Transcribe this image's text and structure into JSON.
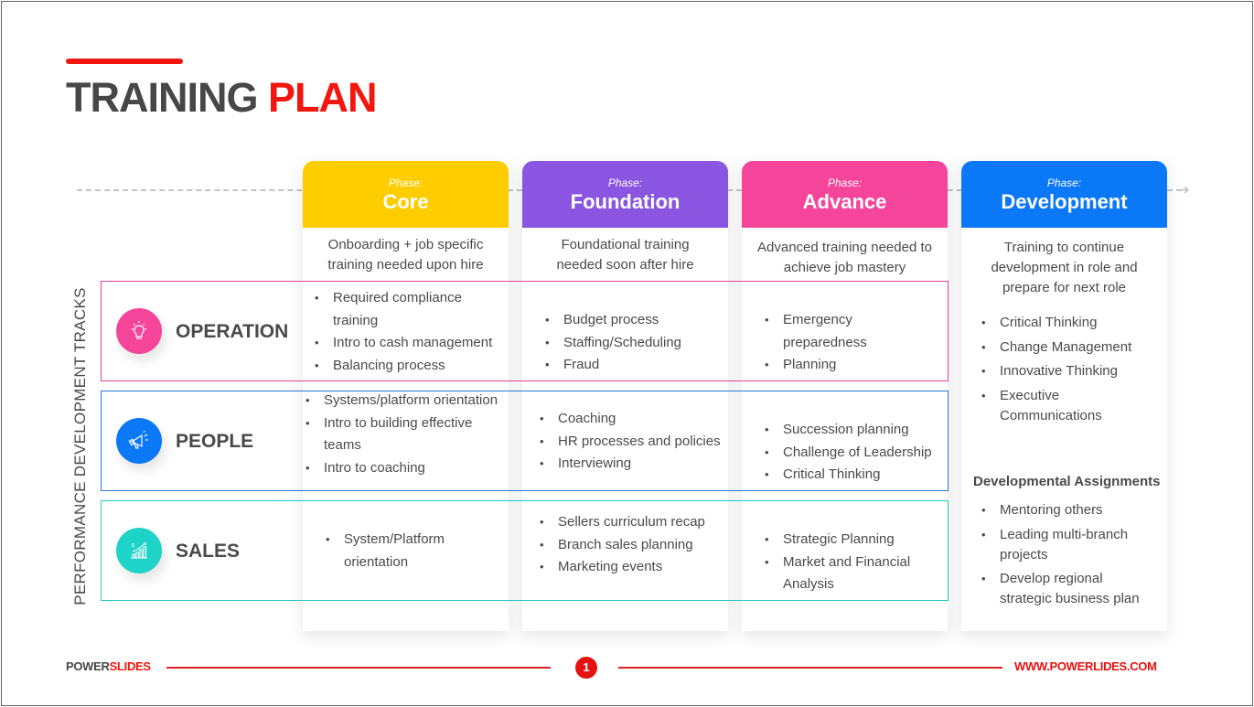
{
  "title": {
    "part1": "TRAINING",
    "part2": "PLAN"
  },
  "side_label": "PERFORMANCE DEVELOPMENT TRACKS",
  "phases": [
    {
      "phase_label": "Phase:",
      "name": "Core",
      "color": "#fdcd00",
      "description": "Onboarding + job specific training needed upon hire"
    },
    {
      "phase_label": "Phase:",
      "name": "Foundation",
      "color": "#8a55e0",
      "description": "Foundational training needed soon after hire"
    },
    {
      "phase_label": "Phase:",
      "name": "Advance",
      "color": "#f5459a",
      "description": "Advanced training needed to achieve job mastery"
    },
    {
      "phase_label": "Phase:",
      "name": "Development",
      "color": "#0a78f7",
      "description": "Training to continue development in role and prepare for next role"
    }
  ],
  "tracks": [
    {
      "name": "OPERATION",
      "icon": "lightbulb-icon",
      "color": "#f5459a",
      "border": "#e0478f",
      "core": [
        "Required compliance training",
        "Intro to cash management",
        "Balancing process"
      ],
      "foundation": [
        "Budget process",
        "Staffing/Scheduling",
        "Fraud"
      ],
      "advance": [
        "Emergency preparedness",
        "Planning"
      ]
    },
    {
      "name": "PEOPLE",
      "icon": "megaphone-icon",
      "color": "#0a78f7",
      "border": "#2a78d6",
      "core": [
        "Systems/platform orientation",
        "Intro to building effective teams",
        "Intro to coaching"
      ],
      "foundation": [
        "Coaching",
        "HR processes and policies",
        "Interviewing"
      ],
      "advance": [
        "Succession planning",
        "Challenge of Leadership",
        "Critical Thinking"
      ]
    },
    {
      "name": "SALES",
      "icon": "growth-chart-icon",
      "color": "#1ed3c8",
      "border": "#22c7c9",
      "core": [
        "System/Platform orientation"
      ],
      "foundation": [
        "Sellers curriculum recap",
        "Branch sales planning",
        "Marketing events"
      ],
      "advance": [
        "Strategic Planning",
        "Market and Financial Analysis"
      ]
    }
  ],
  "development": {
    "items": [
      "Critical Thinking",
      "Change Management",
      "Innovative Thinking",
      "Executive Communications"
    ],
    "assignments_title": "Developmental Assignments",
    "assignments": [
      "Mentoring others",
      "Leading multi-branch projects",
      "Develop regional strategic business plan"
    ]
  },
  "footer": {
    "brand1": "POWER",
    "brand2": "SLIDES",
    "page": "1",
    "url": "WWW.POWERLIDES.COM"
  }
}
